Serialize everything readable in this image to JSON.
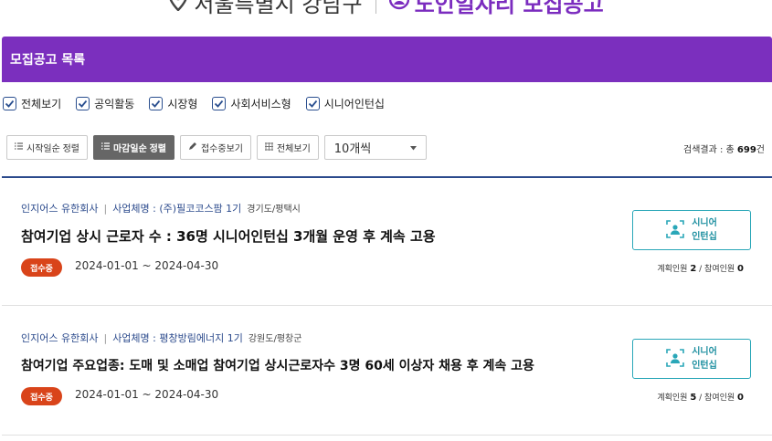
{
  "header": {
    "org_name": "서울특별시 강남구",
    "service_name": "노인일자리 모집공고"
  },
  "list_title": "모집공고 목록",
  "filters": [
    {
      "label": "전체보기",
      "checked": true
    },
    {
      "label": "공익활동",
      "checked": true
    },
    {
      "label": "시장형",
      "checked": true
    },
    {
      "label": "사회서비스형",
      "checked": true
    },
    {
      "label": "시니어인턴십",
      "checked": true
    }
  ],
  "toolbar": {
    "sort_start_label": "시작일순 정렬",
    "sort_end_label": "마감일순 정렬",
    "closed_view_label": "접수중보기",
    "all_view_label": "전체보기",
    "page_size_value": "10개씩",
    "result_prefix": "검색결과 : 총 ",
    "result_count": "699",
    "result_suffix": "건"
  },
  "items": [
    {
      "company": "인지어스 유한회사",
      "business_prefix": "사업체명 : ",
      "business_name": "(주)필코코스팜 1기",
      "location": "경기도/평택시",
      "title": "참여기업 상시 근로자 수 : 36명 시니어인턴십 3개월 운영 후 계속 고용",
      "status": "접수중",
      "period": "2024-01-01 ~ 2024-04-30",
      "type_line1": "시니어",
      "type_line2": "인턴십",
      "planned_label": "계획인원 ",
      "planned": "2",
      "joined_label": " / 참여인원 ",
      "joined": "0"
    },
    {
      "company": "인지어스 유한회사",
      "business_prefix": "사업체명 : ",
      "business_name": "평창방림에너지 1기",
      "location": "강원도/평창군",
      "title": "참여기업 주요업종: 도매 및 소매업 참여기업 상시근로자수 3명 60세 이상자 채용 후 계속 고용",
      "status": "접수중",
      "period": "2024-01-01 ~ 2024-04-30",
      "type_line1": "시니어",
      "type_line2": "인턴십",
      "planned_label": "계획인원 ",
      "planned": "5",
      "joined_label": " / 참여인원 ",
      "joined": "0"
    }
  ],
  "colors": {
    "header_purple": "#7b2fbe",
    "status_orange": "#d9441a",
    "type_teal": "#2aa7b8",
    "navy": "#2b4a8c"
  }
}
